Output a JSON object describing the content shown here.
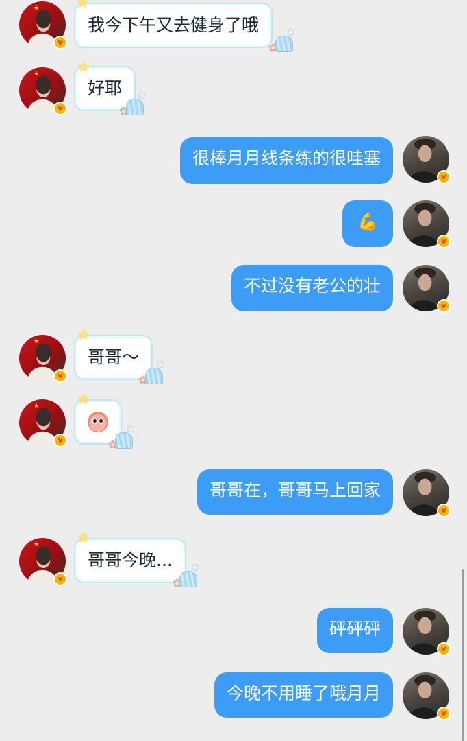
{
  "messages": [
    {
      "side": "in",
      "text": "我今下午又去健身了哦"
    },
    {
      "side": "in",
      "text": "好耶"
    },
    {
      "side": "out",
      "text": "很棒月月线条练的很哇塞"
    },
    {
      "side": "out",
      "text": "💪"
    },
    {
      "side": "out",
      "text": "不过没有老公的壮"
    },
    {
      "side": "in",
      "text": "哥哥～"
    },
    {
      "side": "in",
      "text": "",
      "sticker": "peach-face-sticker"
    },
    {
      "side": "out",
      "text": "哥哥在，哥哥马上回家"
    },
    {
      "side": "in",
      "text": "哥哥今晚..."
    },
    {
      "side": "out",
      "text": "砰砰砰"
    },
    {
      "side": "out",
      "text": "今晚不用睡了哦月月"
    }
  ],
  "badge_letter": "v",
  "colors": {
    "background": "#ededed",
    "outgoing_bubble": "#3d9cf5",
    "incoming_bubble": "#ffffff",
    "incoming_border": "#bfe7ef",
    "verified_badge": "#f7b500"
  }
}
